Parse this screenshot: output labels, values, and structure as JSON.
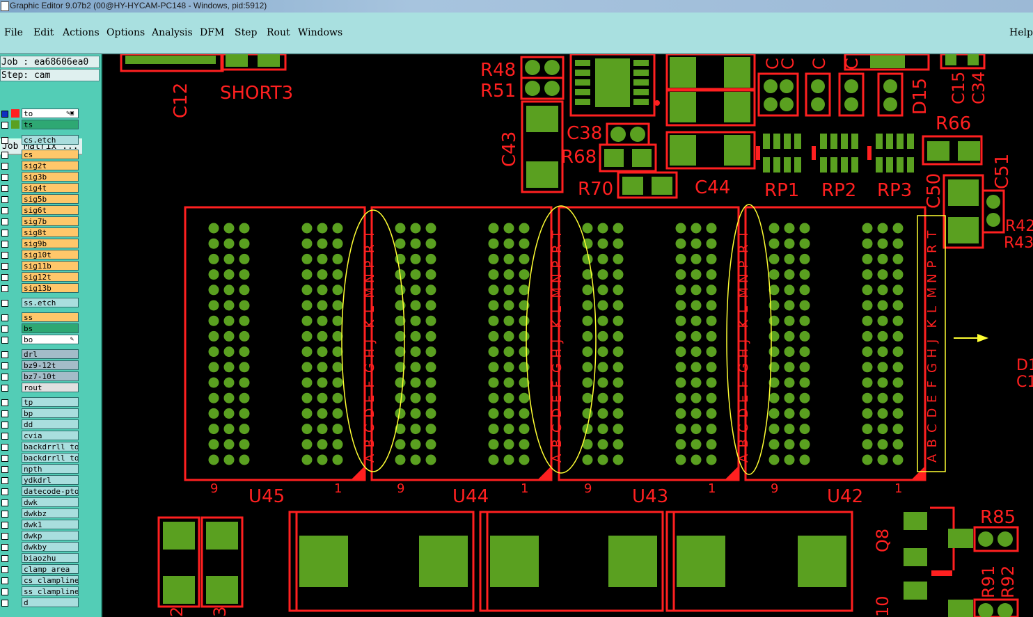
{
  "window": {
    "title": "Graphic Editor 9.07b2 (00@HY-HYCAM-PC148 - Windows, pid:5912)"
  },
  "menu": {
    "items": [
      "File",
      "Edit",
      "Actions",
      "Options",
      "Analysis",
      "DFM",
      "Step",
      "Rout",
      "Windows"
    ],
    "help": "Help"
  },
  "panel": {
    "job": "Job : ea68606ea0",
    "step": "Step: cam",
    "job_matrix": "Job Matrix ..."
  },
  "layers": [
    {
      "name": "to",
      "color": "#ffffff",
      "swatch": "#ff2020",
      "marker": "✎▣",
      "selected": true
    },
    {
      "name": "ts",
      "color": "#2ea873",
      "swatch": "#5aa020"
    },
    {
      "name": "cs.etch",
      "color": "#a9dede"
    },
    {
      "name": "cs",
      "color": "#ffc76a"
    },
    {
      "name": "sig2t",
      "color": "#ffc76a"
    },
    {
      "name": "sig3b",
      "color": "#ffc76a"
    },
    {
      "name": "sig4t",
      "color": "#ffc76a"
    },
    {
      "name": "sig5b",
      "color": "#ffc76a"
    },
    {
      "name": "sig6t",
      "color": "#ffc76a"
    },
    {
      "name": "sig7b",
      "color": "#ffc76a"
    },
    {
      "name": "sig8t",
      "color": "#ffc76a"
    },
    {
      "name": "sig9b",
      "color": "#ffc76a"
    },
    {
      "name": "sig10t",
      "color": "#ffc76a"
    },
    {
      "name": "sig11b",
      "color": "#ffc76a"
    },
    {
      "name": "sig12t",
      "color": "#ffc76a"
    },
    {
      "name": "sig13b",
      "color": "#ffc76a"
    },
    {
      "name": "ss.etch",
      "color": "#a9dede"
    },
    {
      "name": "ss",
      "color": "#ffc76a"
    },
    {
      "name": "bs",
      "color": "#2ea873"
    },
    {
      "name": "bo",
      "color": "#ffffff",
      "marker": "✎"
    },
    {
      "name": "drl",
      "color": "#a4bcc8"
    },
    {
      "name": "bz9-12t",
      "color": "#a4bcc8"
    },
    {
      "name": "bz7-10t",
      "color": "#a4bcc8"
    },
    {
      "name": "rout",
      "color": "#e0e0e0"
    },
    {
      "name": "tp",
      "color": "#a9dede"
    },
    {
      "name": "bp",
      "color": "#a9dede"
    },
    {
      "name": "dd",
      "color": "#a9dede"
    },
    {
      "name": "cvia",
      "color": "#a9dede"
    },
    {
      "name": "backdrrll_to",
      "color": "#a9dede"
    },
    {
      "name": "backdrrll_to",
      "color": "#a9dede"
    },
    {
      "name": "npth",
      "color": "#a9dede"
    },
    {
      "name": "ydkdrl",
      "color": "#a9dede"
    },
    {
      "name": "datecode-pto",
      "color": "#a9dede"
    },
    {
      "name": "dwk",
      "color": "#a9dede"
    },
    {
      "name": "dwkbz",
      "color": "#a9dede"
    },
    {
      "name": "dwk1",
      "color": "#a9dede"
    },
    {
      "name": "dwkp",
      "color": "#a9dede"
    },
    {
      "name": "dwkby",
      "color": "#a9dede"
    },
    {
      "name": "biaozhu",
      "color": "#a9dede"
    },
    {
      "name": "clamp_area",
      "color": "#a9dede"
    },
    {
      "name": "cs_clampline",
      "color": "#a9dede"
    },
    {
      "name": "ss_clampline",
      "color": "#a9dede"
    },
    {
      "name": "d",
      "color": "#a9dede"
    }
  ],
  "colors": {
    "silkscreen": "#ff2020",
    "pad": "#5aa020",
    "highlight": "#ffff33",
    "background": "#000000"
  },
  "board": {
    "chips": [
      "U45",
      "U44",
      "U43",
      "U42"
    ],
    "pin_end_left": "9",
    "pin_end_right": "1",
    "row_letters": "ABCDEFGHJKLMNPRT",
    "refs_top": [
      "C12",
      "SHORT3",
      "R48",
      "R51",
      "C43",
      "C38",
      "R68",
      "R70",
      "C44",
      "RP1",
      "RP2",
      "RP3",
      "R66",
      "C50",
      "C51",
      "D15",
      "C15",
      "C34",
      "R42",
      "R43",
      "D1",
      "C1"
    ],
    "refs_bottom": [
      "Q8",
      "R85",
      "R91",
      "R92"
    ]
  }
}
